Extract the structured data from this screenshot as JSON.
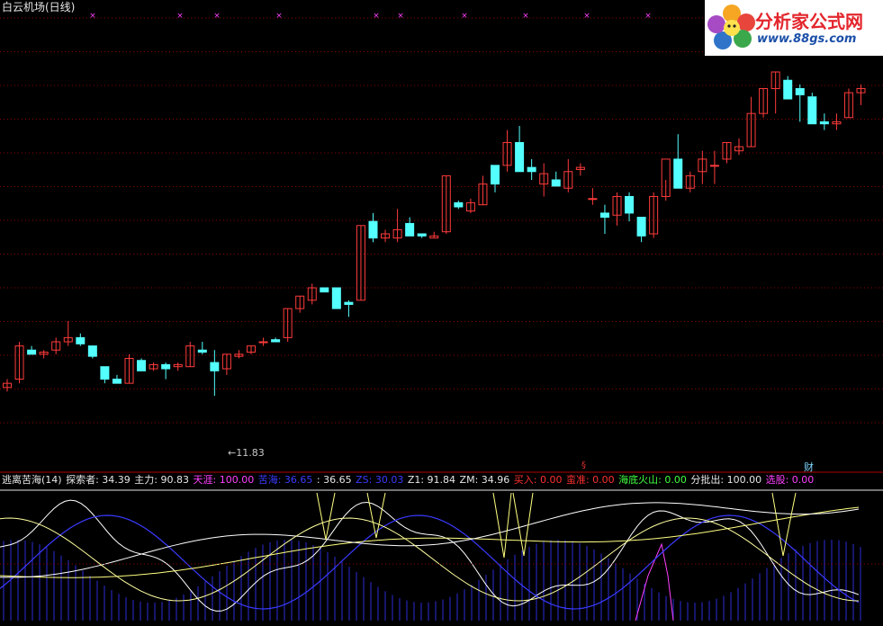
{
  "title": "白云机场(日线)",
  "logo": {
    "brand": "分析家公式网",
    "url": "www.88gs.com"
  },
  "low_marker": "11.83",
  "money_icon": "§",
  "cai_marker": "财",
  "indicator": {
    "name": "逃离苦海(14)",
    "items": [
      {
        "label": "探索者:",
        "value": "34.39",
        "color": "#e6e6e6"
      },
      {
        "label": "主力:",
        "value": "90.83",
        "color": "#e6e6e6"
      },
      {
        "label": "天涯:",
        "value": "100.00",
        "color": "#ff40ff"
      },
      {
        "label": "苦海:",
        "value": "36.65",
        "color": "#3a3aff"
      },
      {
        "label": ":",
        "value": "36.65",
        "color": "#e6e6e6"
      },
      {
        "label": "ZS:",
        "value": "30.03",
        "color": "#3a3aff"
      },
      {
        "label": "Z1:",
        "value": "91.84",
        "color": "#e6e6e6"
      },
      {
        "label": "ZM:",
        "value": "34.96",
        "color": "#e6e6e6"
      },
      {
        "label": "买入:",
        "value": "0.00",
        "color": "#ff3030"
      },
      {
        "label": "蛮准:",
        "value": "0.00",
        "color": "#ff3030"
      },
      {
        "label": "海底火山:",
        "value": "0.00",
        "color": "#40ff40"
      },
      {
        "label": "分批出:",
        "value": "100.00",
        "color": "#e6e6e6"
      },
      {
        "label": "选股:",
        "value": "0.00",
        "color": "#ff40ff"
      }
    ]
  },
  "colors": {
    "up": "#ff3b3b",
    "down": "#54ffff",
    "grid": "#8b0000",
    "axis": "#b00000"
  },
  "chart_data": {
    "type": "candlestick",
    "ylim": [
      10.6,
      19.7
    ],
    "candles": [
      [
        12.1,
        12.3,
        12.0,
        12.2
      ],
      [
        12.3,
        13.2,
        12.2,
        13.1
      ],
      [
        13.0,
        13.1,
        12.9,
        12.9
      ],
      [
        12.9,
        13.0,
        12.8,
        12.95
      ],
      [
        13.0,
        13.3,
        12.9,
        13.2
      ],
      [
        13.2,
        13.7,
        13.1,
        13.3
      ],
      [
        13.3,
        13.4,
        13.1,
        13.15
      ],
      [
        13.1,
        13.1,
        12.8,
        12.85
      ],
      [
        12.6,
        12.6,
        12.2,
        12.3
      ],
      [
        12.3,
        12.4,
        12.2,
        12.2
      ],
      [
        12.2,
        12.9,
        12.2,
        12.8
      ],
      [
        12.75,
        12.8,
        12.6,
        12.5
      ],
      [
        12.55,
        12.7,
        12.5,
        12.65
      ],
      [
        12.65,
        12.7,
        12.3,
        12.55
      ],
      [
        12.6,
        12.7,
        12.5,
        12.65
      ],
      [
        12.6,
        13.2,
        12.6,
        13.1
      ],
      [
        13.0,
        13.2,
        12.9,
        12.95
      ],
      [
        12.7,
        13.0,
        11.9,
        12.5
      ],
      [
        12.55,
        12.9,
        12.4,
        12.9
      ],
      [
        12.85,
        13.0,
        12.8,
        12.9
      ],
      [
        12.95,
        13.1,
        12.9,
        13.1
      ],
      [
        13.2,
        13.3,
        13.1,
        13.2
      ],
      [
        13.25,
        13.3,
        13.2,
        13.2
      ],
      [
        13.3,
        14.0,
        13.2,
        14.0
      ],
      [
        14.0,
        14.3,
        13.9,
        14.3
      ],
      [
        14.2,
        14.6,
        14.1,
        14.5
      ],
      [
        14.5,
        14.5,
        14.4,
        14.4
      ],
      [
        14.5,
        14.5,
        14.0,
        14.0
      ],
      [
        14.15,
        14.2,
        13.8,
        14.1
      ],
      [
        14.2,
        16.0,
        14.2,
        16.0
      ],
      [
        16.1,
        16.3,
        15.6,
        15.7
      ],
      [
        15.7,
        15.9,
        15.6,
        15.8
      ],
      [
        15.7,
        16.4,
        15.6,
        15.9
      ],
      [
        16.05,
        16.2,
        15.8,
        15.75
      ],
      [
        15.8,
        15.8,
        15.7,
        15.75
      ],
      [
        15.7,
        15.85,
        15.7,
        15.75
      ],
      [
        15.85,
        17.2,
        15.8,
        17.2
      ],
      [
        16.55,
        16.6,
        16.4,
        16.45
      ],
      [
        16.35,
        16.65,
        16.3,
        16.55
      ],
      [
        16.5,
        17.2,
        16.5,
        17.0
      ],
      [
        17.45,
        17.45,
        16.8,
        17.0
      ],
      [
        17.45,
        18.3,
        17.3,
        18.0
      ],
      [
        18.0,
        18.4,
        17.6,
        17.3
      ],
      [
        17.4,
        17.6,
        17.1,
        17.3
      ],
      [
        17.0,
        17.5,
        16.7,
        17.25
      ],
      [
        17.1,
        17.3,
        17.0,
        16.95
      ],
      [
        16.9,
        17.6,
        16.8,
        17.3
      ],
      [
        17.35,
        17.5,
        17.2,
        17.4
      ],
      [
        16.65,
        16.9,
        16.5,
        16.65
      ],
      [
        16.3,
        16.5,
        15.8,
        16.2
      ],
      [
        16.25,
        16.8,
        16.0,
        16.7
      ],
      [
        16.7,
        16.8,
        16.1,
        16.3
      ],
      [
        16.2,
        16.2,
        15.6,
        15.75
      ],
      [
        15.8,
        16.8,
        15.7,
        16.7
      ],
      [
        16.7,
        17.1,
        16.6,
        17.6
      ],
      [
        17.6,
        18.2,
        17.0,
        16.9
      ],
      [
        16.9,
        17.3,
        16.8,
        17.2
      ],
      [
        17.3,
        17.8,
        17.0,
        17.6
      ],
      [
        17.45,
        17.8,
        17.0,
        17.45
      ],
      [
        17.6,
        18.0,
        17.5,
        18.0
      ],
      [
        17.8,
        18.1,
        17.7,
        17.9
      ],
      [
        17.9,
        19.1,
        17.9,
        18.7
      ],
      [
        18.7,
        19.3,
        18.6,
        19.3
      ],
      [
        19.3,
        19.7,
        18.7,
        19.7
      ],
      [
        19.5,
        19.6,
        19.1,
        19.05
      ],
      [
        19.3,
        19.4,
        18.5,
        19.15
      ],
      [
        19.1,
        19.2,
        18.6,
        18.45
      ],
      [
        18.5,
        18.7,
        18.3,
        18.45
      ],
      [
        18.45,
        18.7,
        18.3,
        18.5
      ],
      [
        18.6,
        19.3,
        18.6,
        19.2
      ],
      [
        19.2,
        19.4,
        18.9,
        19.3
      ]
    ],
    "markers_x_count": 10,
    "low_price": 11.83
  }
}
